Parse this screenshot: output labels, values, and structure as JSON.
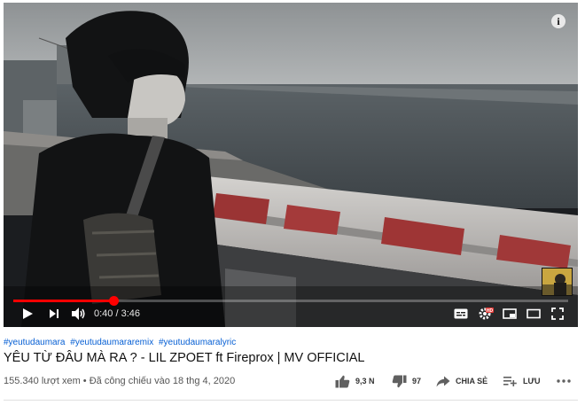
{
  "player": {
    "info_label": "i",
    "progress_fraction": 0.18,
    "time": {
      "current": "0:40",
      "separator": " / ",
      "duration": "3:46"
    },
    "hd_badge": "HD"
  },
  "video": {
    "hashtags": [
      "#yeutudaumara",
      "#yeutudaumararemix",
      "#yeutudaumaralyric"
    ],
    "title": "YÊU TỪ ĐÂU MÀ RA ? - LIL ZPOET ft Fireprox | MV OFFICIAL",
    "views": "155.340 lượt xem",
    "meta_separator": " • ",
    "premiere": "Đã công chiếu vào 18 thg 4, 2020"
  },
  "actions": {
    "like_count": "9,3 N",
    "dislike_count": "97",
    "share_label": "CHIA SẺ",
    "save_label": "LƯU"
  },
  "colors": {
    "progress": "#ff0000",
    "hashtag": "#065fd4"
  }
}
